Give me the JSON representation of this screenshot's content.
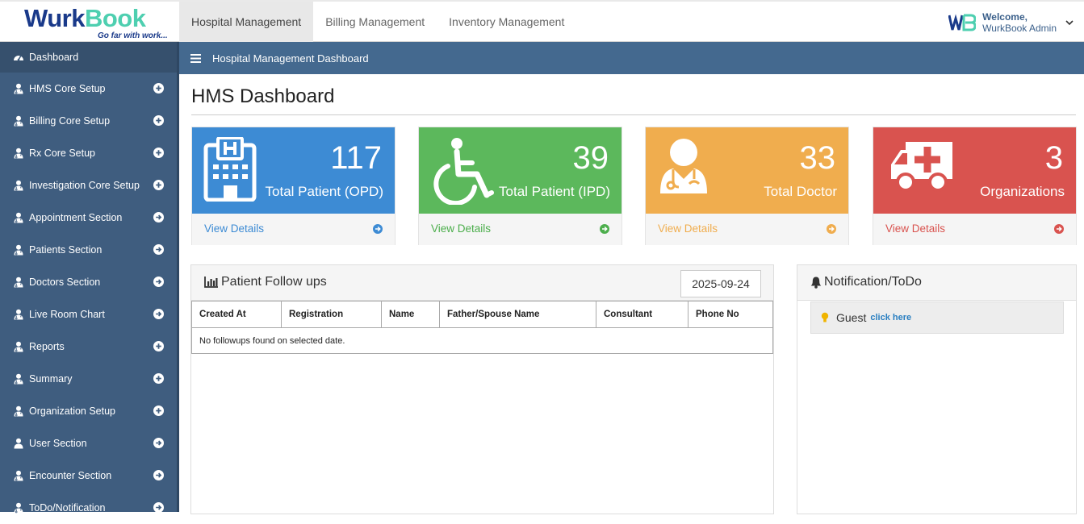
{
  "brand": {
    "name_part1": "Wurk",
    "name_part2": "Book",
    "tagline": "Go far with work..."
  },
  "topnav": [
    {
      "label": "Hospital Management",
      "active": true
    },
    {
      "label": "Billing Management",
      "active": false
    },
    {
      "label": "Inventory Management",
      "active": false
    }
  ],
  "user": {
    "welcome": "Welcome,",
    "name": "WurkBook Admin",
    "icon": "chevron-down-icon"
  },
  "sidebar": {
    "items": [
      {
        "label": "Dashboard",
        "icon": "dashboard-icon"
      },
      {
        "label": "HMS Core Setup",
        "icon": "user-md-icon",
        "action": "plus"
      },
      {
        "label": "Billing Core Setup",
        "icon": "user-md-icon",
        "action": "plus"
      },
      {
        "label": "Rx Core Setup",
        "icon": "user-md-icon",
        "action": "plus"
      },
      {
        "label": "Investigation Core Setup",
        "icon": "user-md-icon",
        "action": "plus"
      },
      {
        "label": "Appointment Section",
        "icon": "user-md-icon",
        "action": "arrow"
      },
      {
        "label": "Patients Section",
        "icon": "user-md-icon",
        "action": "arrow"
      },
      {
        "label": "Doctors Section",
        "icon": "user-md-icon",
        "action": "arrow"
      },
      {
        "label": "Live Room Chart",
        "icon": "user-md-icon",
        "action": "arrow"
      },
      {
        "label": "Reports",
        "icon": "user-md-icon",
        "action": "plus"
      },
      {
        "label": "Summary",
        "icon": "user-md-icon",
        "action": "plus"
      },
      {
        "label": "Organization Setup",
        "icon": "user-md-icon",
        "action": "plus"
      },
      {
        "label": "User Section",
        "icon": "user-icon",
        "action": "arrow"
      },
      {
        "label": "Encounter Section",
        "icon": "user-md-icon",
        "action": "arrow"
      },
      {
        "label": "ToDo/Notification",
        "icon": "user-md-icon",
        "action": "arrow"
      }
    ]
  },
  "main": {
    "bar_title": "Hospital Management Dashboard",
    "page_title": "HMS Dashboard"
  },
  "cards": [
    {
      "value": "117",
      "label": "Total Patient (OPD)",
      "link": "View Details",
      "color": "#3d8bd4",
      "link_color": "#3d8bd4",
      "icon": "hospital-icon"
    },
    {
      "value": "39",
      "label": "Total Patient (IPD)",
      "link": "View Details",
      "color": "#5cb85c",
      "link_color": "#4cae4c",
      "icon": "wheelchair-icon"
    },
    {
      "value": "33",
      "label": "Total Doctor",
      "link": "View Details",
      "color": "#f0ad4e",
      "link_color": "#f0ad4e",
      "icon": "doctor-icon"
    },
    {
      "value": "3",
      "label": "Organizations",
      "link": "View Details",
      "color": "#d9534f",
      "link_color": "#d9534f",
      "icon": "ambulance-icon"
    }
  ],
  "followups": {
    "title": "Patient Follow ups",
    "date": "2025-09-24",
    "columns": [
      "Created At",
      "Registration",
      "Name",
      "Father/Spouse Name",
      "Consultant",
      "Phone No"
    ],
    "empty_message": "No followups found on selected date."
  },
  "notification": {
    "title": "Notification/ToDo",
    "user": "Guest",
    "link": "click here"
  }
}
